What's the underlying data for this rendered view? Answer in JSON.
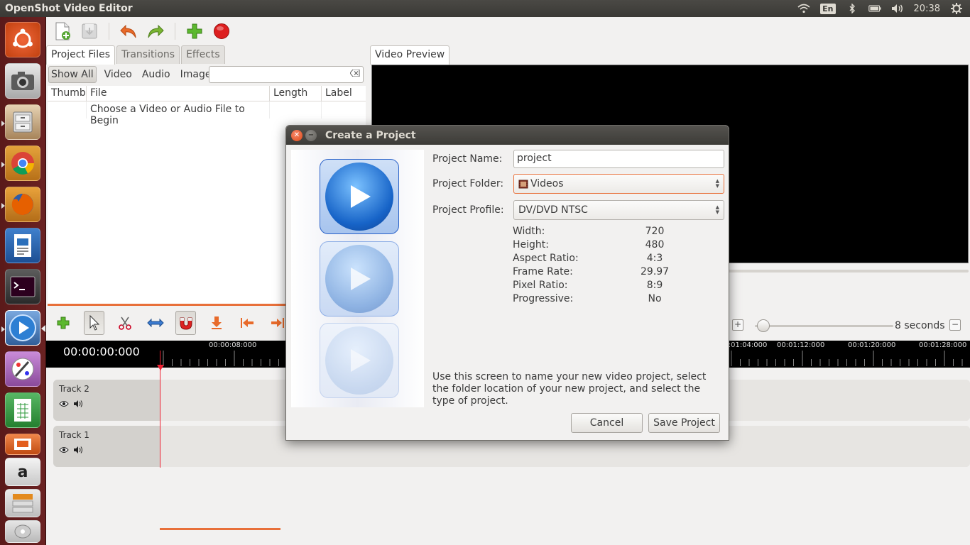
{
  "top_panel": {
    "app_title": "OpenShot Video Editor",
    "keyboard_layout": "En",
    "clock": "20:38",
    "icons": [
      "wifi-icon",
      "keyboard-icon",
      "bluetooth-icon",
      "battery-icon",
      "volume-icon",
      "clock",
      "settings-gear-icon"
    ]
  },
  "launcher": {
    "items": [
      {
        "name": "ubuntu-dash",
        "icon": "ubuntu-logo-icon",
        "color": "#e95420"
      },
      {
        "name": "camera-app",
        "icon": "camera-icon",
        "color": "#cfcfcf"
      },
      {
        "name": "files",
        "icon": "file-cabinet-icon",
        "color": "#c9a57a"
      },
      {
        "name": "chrome",
        "icon": "chrome-icon",
        "color": "#4285f4"
      },
      {
        "name": "firefox",
        "icon": "firefox-icon",
        "color": "#e66000"
      },
      {
        "name": "writer",
        "icon": "document-writer-icon",
        "color": "#2a6fbb"
      },
      {
        "name": "terminal",
        "icon": "terminal-icon",
        "color": "#2b2b2b"
      },
      {
        "name": "openshot",
        "icon": "openshot-play-icon",
        "color": "#3a8de0"
      },
      {
        "name": "paint",
        "icon": "paint-brush-icon",
        "color": "#c27fd0"
      },
      {
        "name": "calc",
        "icon": "spreadsheet-icon",
        "color": "#2e9a3b"
      },
      {
        "name": "impress",
        "icon": "presentation-icon",
        "color": "#e35e1e"
      },
      {
        "name": "amazon",
        "icon": "amazon-icon",
        "color": "#e38a1e"
      }
    ]
  },
  "toolbar": {
    "buttons": [
      "new-project-icon",
      "save-project-icon",
      "undo-icon",
      "redo-icon",
      "import-files-icon",
      "export-video-icon"
    ]
  },
  "left_pane": {
    "tabs": [
      "Project Files",
      "Transitions",
      "Effects"
    ],
    "filters": [
      "Show All",
      "Video",
      "Audio",
      "Image"
    ],
    "search_placeholder": "",
    "columns": [
      "Thumb",
      "File",
      "Length",
      "Label"
    ],
    "empty_message": "Choose a Video or Audio File to Begin"
  },
  "right_pane": {
    "tab": "Video Preview"
  },
  "timeline": {
    "timecode": "00:00:00:000",
    "zoom_label": "8 seconds",
    "zoom_value": 0.05,
    "ruler_labels": [
      "00:00:08:000",
      "00:01:04:000",
      "00:01:12:000",
      "00:01:20:000",
      "00:01:28:000"
    ],
    "tracks": [
      {
        "name": "Track 2"
      },
      {
        "name": "Track 1"
      }
    ]
  },
  "dialog": {
    "title": "Create a Project",
    "fields": {
      "name_label": "Project Name:",
      "name_value": "project",
      "folder_label": "Project Folder:",
      "folder_value": "Videos",
      "profile_label": "Project Profile:",
      "profile_value": "DV/DVD NTSC"
    },
    "properties": [
      {
        "key": "Width:",
        "value": "720"
      },
      {
        "key": "Height:",
        "value": "480"
      },
      {
        "key": "Aspect Ratio:",
        "value": "4:3"
      },
      {
        "key": "Frame Rate:",
        "value": "29.97"
      },
      {
        "key": "Pixel Ratio:",
        "value": "8:9"
      },
      {
        "key": "Progressive:",
        "value": "No"
      }
    ],
    "description": "Use this screen to name your new video project, select the folder location of your new project, and select the type of project.",
    "cancel_label": "Cancel",
    "save_label": "Save Project"
  }
}
